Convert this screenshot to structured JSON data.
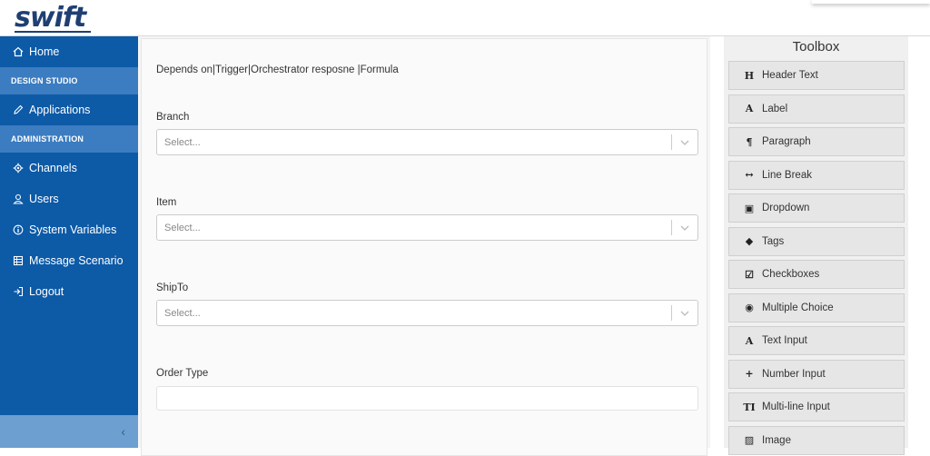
{
  "brand": {
    "logo_text": "swift",
    "color": "#1f3f73"
  },
  "sidebar": {
    "color": "#0d5aa7",
    "home": {
      "label": "Home",
      "icon": "home-icon"
    },
    "section_design": "DESIGN STUDIO",
    "applications": {
      "label": "Applications",
      "icon": "pencil-icon"
    },
    "section_admin": "ADMINISTRATION",
    "items": [
      {
        "label": "Channels",
        "icon": "gear-icon"
      },
      {
        "label": "Users",
        "icon": "user-icon"
      },
      {
        "label": "System Variables",
        "icon": "info-icon"
      },
      {
        "label": "Message Scenario",
        "icon": "table-icon"
      },
      {
        "label": "Logout",
        "icon": "logout-icon"
      }
    ],
    "collapse_glyph": "‹"
  },
  "form": {
    "depends_text": "Depends on|Trigger|Orchestrator resposne |Formula",
    "fields": [
      {
        "label": "Branch",
        "placeholder": "Select..."
      },
      {
        "label": "Item",
        "placeholder": "Select..."
      },
      {
        "label": "ShipTo",
        "placeholder": "Select..."
      },
      {
        "label": "Order Type",
        "value": ""
      }
    ]
  },
  "toolbox": {
    "title": "Toolbox",
    "items": [
      {
        "label": "Header Text",
        "glyph": "H"
      },
      {
        "label": "Label",
        "glyph": "A"
      },
      {
        "label": "Paragraph",
        "glyph": "¶"
      },
      {
        "label": "Line Break",
        "glyph": "↔"
      },
      {
        "label": "Dropdown",
        "glyph": "▣"
      },
      {
        "label": "Tags",
        "glyph": "◆"
      },
      {
        "label": "Checkboxes",
        "glyph": "☑"
      },
      {
        "label": "Multiple Choice",
        "glyph": "◉"
      },
      {
        "label": "Text Input",
        "glyph": "A"
      },
      {
        "label": "Number Input",
        "glyph": "+"
      },
      {
        "label": "Multi-line Input",
        "glyph": "TI"
      },
      {
        "label": "Image",
        "glyph": "▨"
      }
    ]
  }
}
